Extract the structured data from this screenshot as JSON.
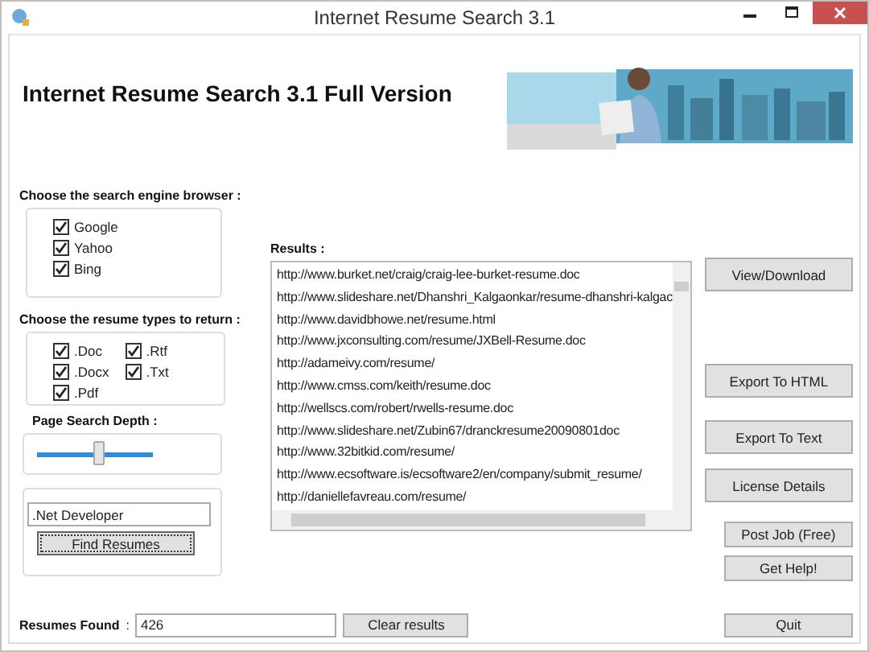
{
  "window": {
    "title": "Internet Resume Search 3.1"
  },
  "heading": "Internet Resume Search 3.1 Full Version",
  "engines": {
    "label": "Choose the search engine  browser :",
    "items": [
      {
        "label": "Google",
        "checked": true
      },
      {
        "label": "Yahoo",
        "checked": true
      },
      {
        "label": "Bing",
        "checked": true
      }
    ]
  },
  "types": {
    "label": "Choose the resume types to return :",
    "items": [
      {
        "label": ".Doc",
        "checked": true
      },
      {
        "label": ".Rtf",
        "checked": true
      },
      {
        "label": ".Docx",
        "checked": true
      },
      {
        "label": ".Txt",
        "checked": true
      },
      {
        "label": ".Pdf",
        "checked": true
      }
    ]
  },
  "depth": {
    "label": "Page Search Depth :",
    "level": 0.53
  },
  "search": {
    "value": ".Net Developer",
    "button": "Find Resumes"
  },
  "results": {
    "label": "Results :",
    "rows": [
      "http://www.burket.net/craig/craig-lee-burket-resume.doc",
      "http://www.slideshare.net/Dhanshri_Kalgaonkar/resume-dhanshri-kalgac",
      "http://www.davidbhowe.net/resume.html",
      "http://www.jxconsulting.com/resume/JXBell-Resume.doc",
      "http://adameivy.com/resume/",
      "http://www.cmss.com/keith/resume.doc",
      "http://wellscs.com/robert/rwells-resume.doc",
      "http://www.slideshare.net/Zubin67/dranckresume20090801doc",
      "http://www.32bitkid.com/resume/",
      "http://www.ecsoftware.is/ecsoftware2/en/company/submit_resume/",
      "http://daniellefavreau.com/resume/"
    ]
  },
  "found": {
    "label": "Resumes Found",
    "separator": ":",
    "value": "426",
    "button": "Clear results"
  },
  "actions": [
    {
      "label": "View/Download",
      "kind": "main"
    },
    {
      "label": "Export To HTML",
      "kind": "main"
    },
    {
      "label": "Export To Text",
      "kind": "main"
    },
    {
      "label": "License Details",
      "kind": "main"
    },
    {
      "label": "Post Job (Free)",
      "kind": "small"
    },
    {
      "label": "Get Help!",
      "kind": "small"
    },
    {
      "label": "Quit",
      "kind": "small"
    }
  ]
}
